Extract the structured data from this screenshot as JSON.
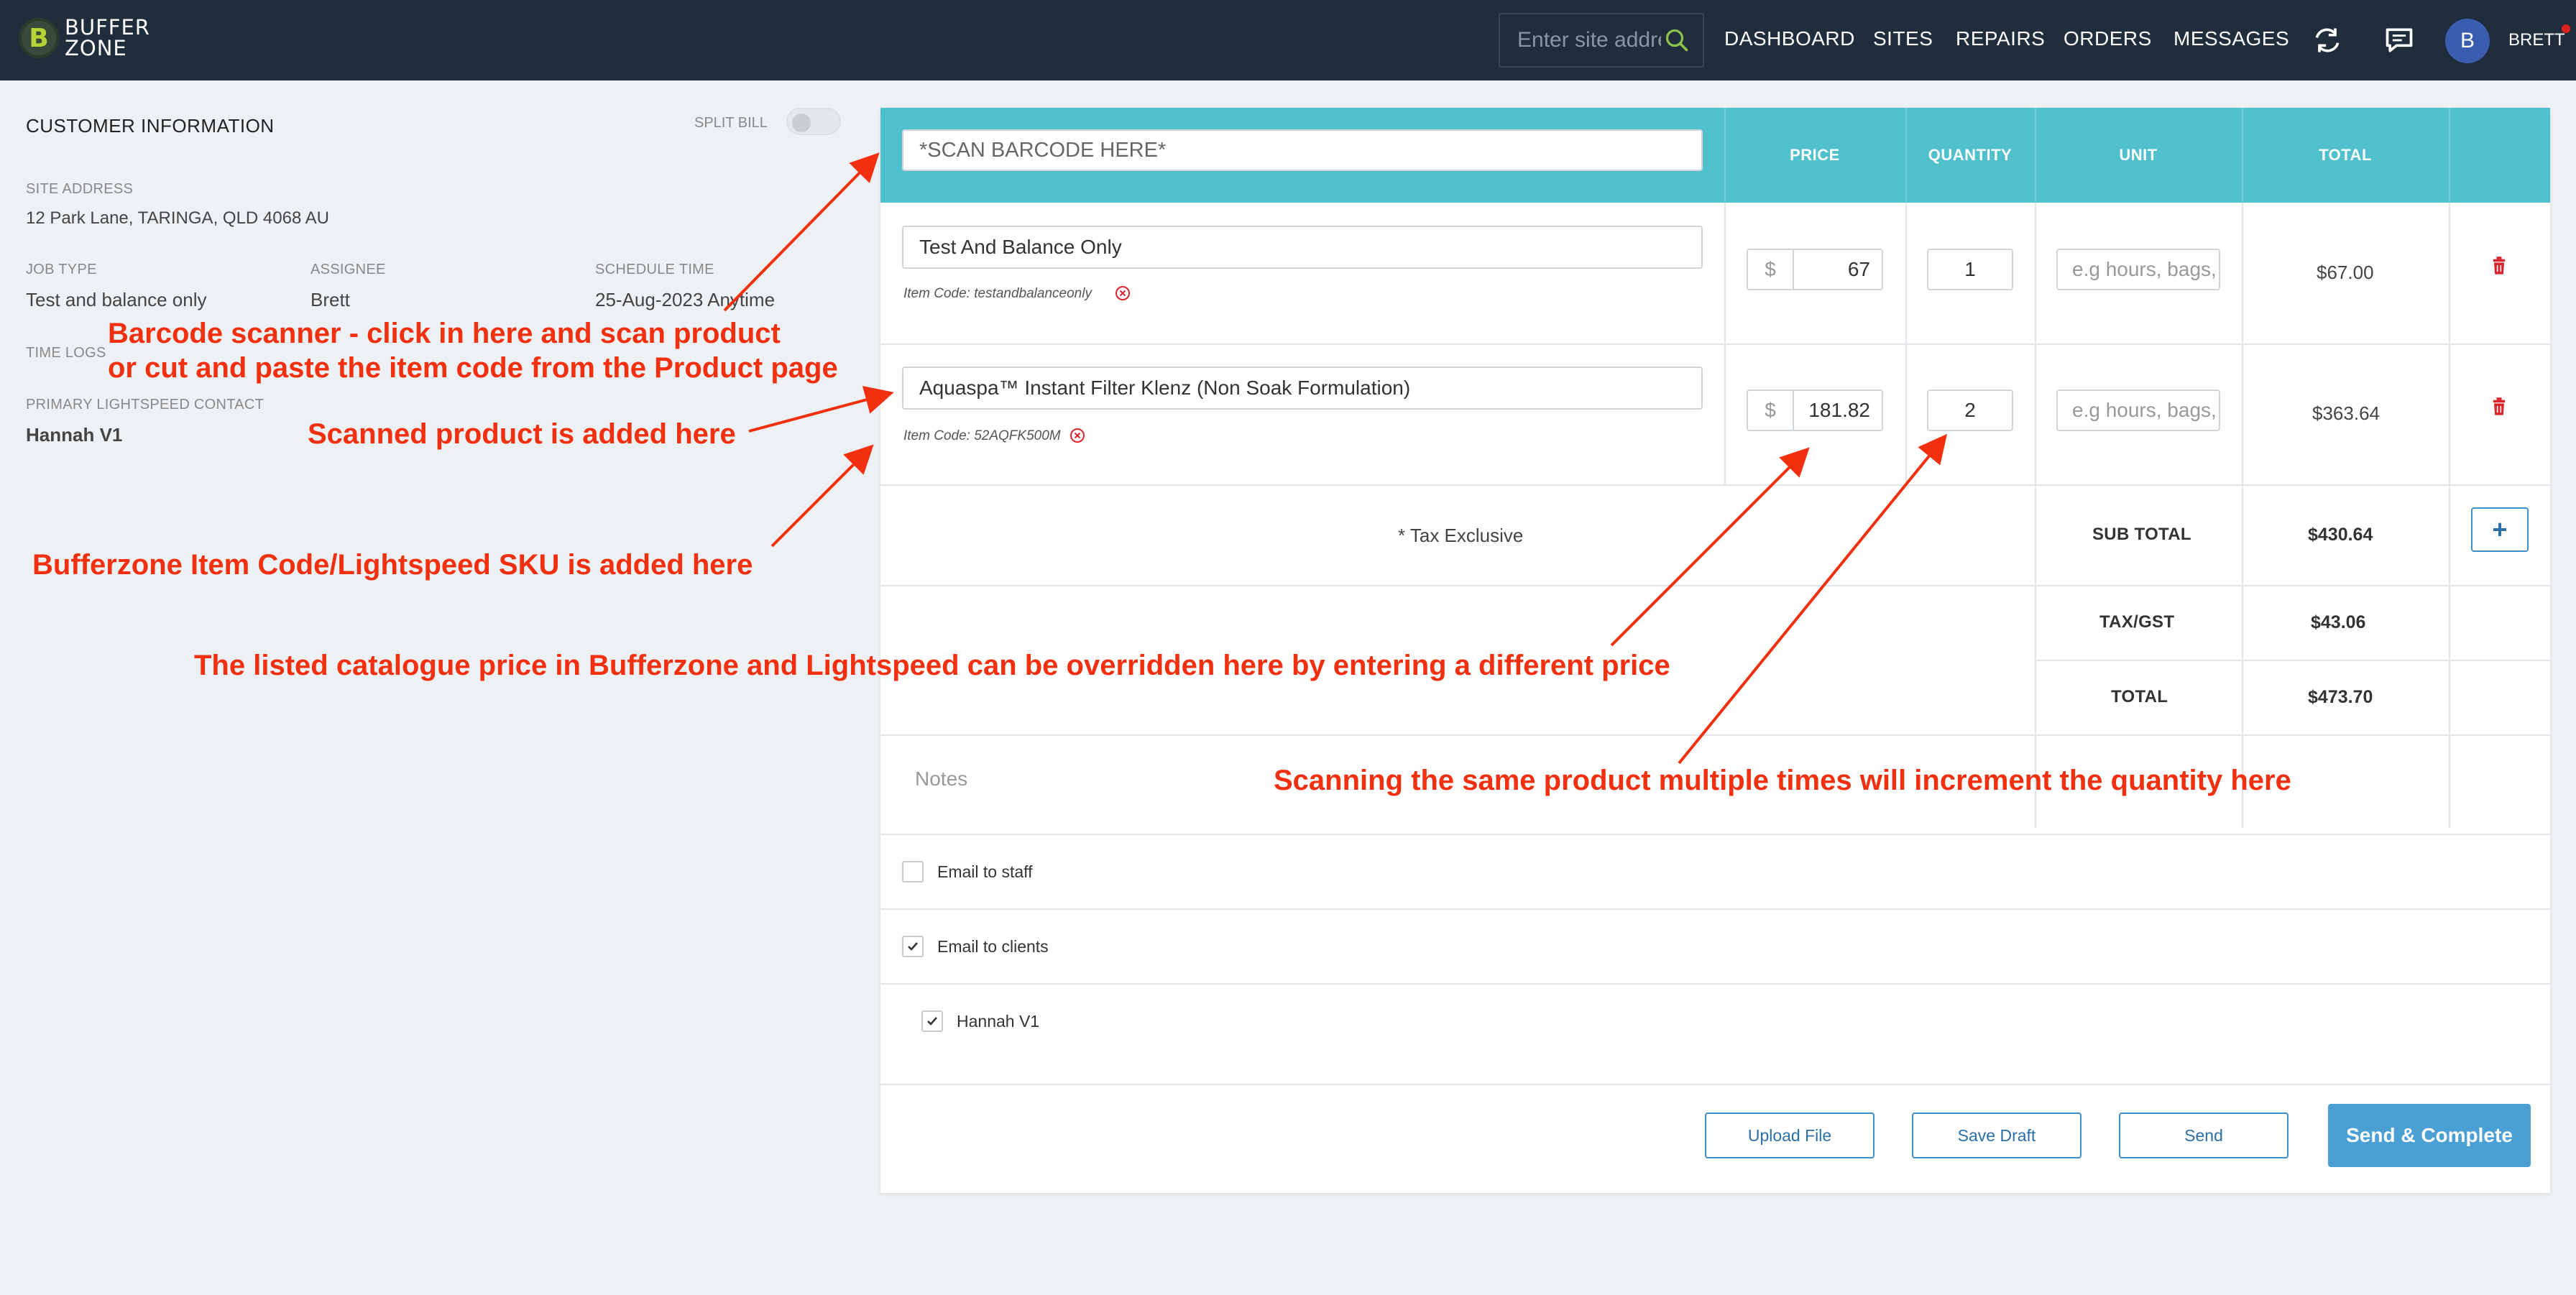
{
  "app": {
    "logo_line1": "BUFFER",
    "logo_line2": "ZONE",
    "logo_mark": "B",
    "search_placeholder": "Enter site address",
    "nav": [
      "DASHBOARD",
      "SITES",
      "REPAIRS",
      "ORDERS",
      "MESSAGES"
    ],
    "avatar_initial": "B",
    "user": "BRETT"
  },
  "customer": {
    "title": "CUSTOMER INFORMATION",
    "split_bill_label": "SPLIT BILL",
    "split_bill_on": false,
    "site_address_label": "SITE ADDRESS",
    "site_address": "12 Park Lane, TARINGA, QLD 4068 AU",
    "job_type_label": "JOB TYPE",
    "job_type": "Test and balance only",
    "assignee_label": "ASSIGNEE",
    "assignee": "Brett",
    "schedule_label": "SCHEDULE TIME",
    "schedule": "25-Aug-2023 Anytime",
    "time_logs_label": "TIME LOGS",
    "contact_label": "PRIMARY LIGHTSPEED CONTACT",
    "contact": "Hannah V1"
  },
  "invoice": {
    "barcode_placeholder": "*SCAN BARCODE HERE*",
    "headers": {
      "price": "PRICE",
      "quantity": "QUANTITY",
      "unit": "UNIT",
      "total": "TOTAL"
    },
    "currency_symbol": "$",
    "unit_placeholder": "e.g hours, bags, etc",
    "items": [
      {
        "name": "Test And Balance Only",
        "code": "Item Code: testandbalanceonly",
        "price": "67",
        "quantity": "1",
        "total": "$67.00"
      },
      {
        "name": "Aquaspa™ Instant Filter Klenz (Non Soak Formulation)",
        "code": "Item Code: 52AQFK500M",
        "price": "181.82",
        "quantity": "2",
        "total": "$363.64"
      }
    ],
    "tax_note": "* Tax Exclusive",
    "subtotal_label": "SUB TOTAL",
    "subtotal": "$430.64",
    "tax_label": "TAX/GST",
    "tax": "$43.06",
    "total_label": "TOTAL",
    "total": "$473.70",
    "add_label": "+",
    "notes_placeholder": "Notes",
    "email_staff_label": "Email to staff",
    "email_staff_checked": false,
    "email_clients_label": "Email to clients",
    "email_clients_checked": true,
    "client_name": "Hannah V1",
    "client_checked": true,
    "buttons": {
      "upload": "Upload File",
      "save_draft": "Save Draft",
      "send": "Send",
      "send_complete": "Send & Complete"
    }
  },
  "annotations": {
    "barcode_line1": "Barcode  scanner  - click in here and scan product",
    "barcode_line2": "or cut and paste the item code from the Product page",
    "scanned": "Scanned product is added here",
    "item_code": "Bufferzone Item Code/Lightspeed SKU is added here",
    "price_override": "The listed catalogue price in Bufferzone and Lightspeed can be overridden here by entering a different price",
    "quantity": "Scanning the same product multiple times will increment the quantity here"
  },
  "colors": {
    "nav_bg": "#1f2d3d",
    "table_header": "#4fc0cc",
    "primary_button": "#4a9fd4",
    "annotation": "#f2300f",
    "delete_icon": "#d9242c"
  }
}
